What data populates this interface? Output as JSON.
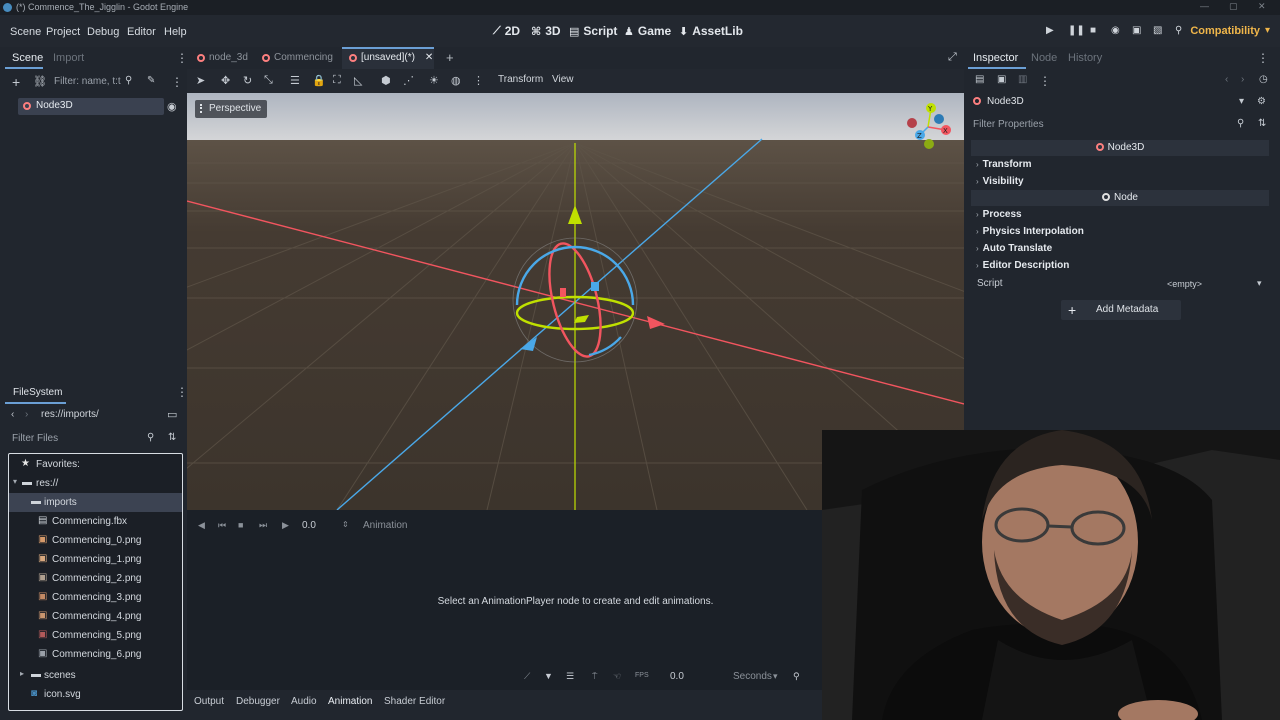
{
  "window": {
    "title": "(*) Commence_The_Jigglin - Godot Engine"
  },
  "menu": [
    "Scene",
    "Project",
    "Debug",
    "Editor",
    "Help"
  ],
  "workspaces": [
    {
      "label": "2D",
      "icon": "2d-icon"
    },
    {
      "label": "3D",
      "icon": "3d-icon"
    },
    {
      "label": "Script",
      "icon": "script-icon"
    },
    {
      "label": "Game",
      "icon": "game-icon"
    },
    {
      "label": "AssetLib",
      "icon": "assetlib-icon"
    }
  ],
  "renderer": "Compatibility",
  "scene_dock": {
    "tabs": [
      "Scene",
      "Import"
    ],
    "filter_placeholder": "Filter: name, t:t",
    "root_node": "Node3D"
  },
  "filesystem": {
    "title": "FileSystem",
    "path": "res://imports/",
    "filter_placeholder": "Filter Files",
    "items": [
      {
        "label": "Favorites:",
        "icon": "star-icon",
        "indent": 0
      },
      {
        "label": "res://",
        "icon": "folder-icon",
        "indent": 0
      },
      {
        "label": "imports",
        "icon": "folder-icon",
        "indent": 1,
        "selected": true
      },
      {
        "label": "Commencing.fbx",
        "icon": "scene-file-icon",
        "indent": 2
      },
      {
        "label": "Commencing_0.png",
        "icon": "image-icon",
        "indent": 2
      },
      {
        "label": "Commencing_1.png",
        "icon": "image-icon",
        "indent": 2
      },
      {
        "label": "Commencing_2.png",
        "icon": "image-icon",
        "indent": 2
      },
      {
        "label": "Commencing_3.png",
        "icon": "image-icon",
        "indent": 2
      },
      {
        "label": "Commencing_4.png",
        "icon": "image-icon",
        "indent": 2
      },
      {
        "label": "Commencing_5.png",
        "icon": "image-icon",
        "indent": 2
      },
      {
        "label": "Commencing_6.png",
        "icon": "image-icon",
        "indent": 2
      },
      {
        "label": "scenes",
        "icon": "folder-icon",
        "indent": 1
      },
      {
        "label": "icon.svg",
        "icon": "svg-icon",
        "indent": 1
      }
    ]
  },
  "doc_tabs": [
    {
      "label": "node_3d",
      "active": false
    },
    {
      "label": "Commencing",
      "active": false
    },
    {
      "label": "[unsaved](*)",
      "active": true
    }
  ],
  "viewport_toolbar": {
    "transform": "Transform",
    "view": "View"
  },
  "viewport": {
    "perspective": "Perspective",
    "gizmo_axes": [
      "X",
      "Y",
      "Z"
    ]
  },
  "animation": {
    "time": "0.0",
    "label": "Animation",
    "message": "Select an AnimationPlayer node to create and edit animations.",
    "fps_label": "FPS",
    "fps_value": "0.0",
    "unit": "Seconds"
  },
  "bottom_tabs": [
    "Output",
    "Debugger",
    "Audio",
    "Animation",
    "Shader Editor"
  ],
  "inspector": {
    "tabs": [
      "Inspector",
      "Node",
      "History"
    ],
    "object": "Node3D",
    "filter_placeholder": "Filter Properties",
    "sections": [
      {
        "header": "Node3D",
        "categories": [
          "Transform",
          "Visibility"
        ]
      },
      {
        "header": "Node",
        "categories": [
          "Process",
          "Physics Interpolation",
          "Auto Translate",
          "Editor Description"
        ]
      }
    ],
    "script_label": "Script",
    "script_value": "<empty>",
    "add_metadata": "Add Metadata"
  },
  "colors": {
    "x_axis": "#f2555f",
    "y_axis": "#c0e000",
    "z_axis": "#4aa8e8",
    "accent": "#6b9fd5",
    "node_icon": "#fc7f7f",
    "compat": "#f0b64a"
  }
}
